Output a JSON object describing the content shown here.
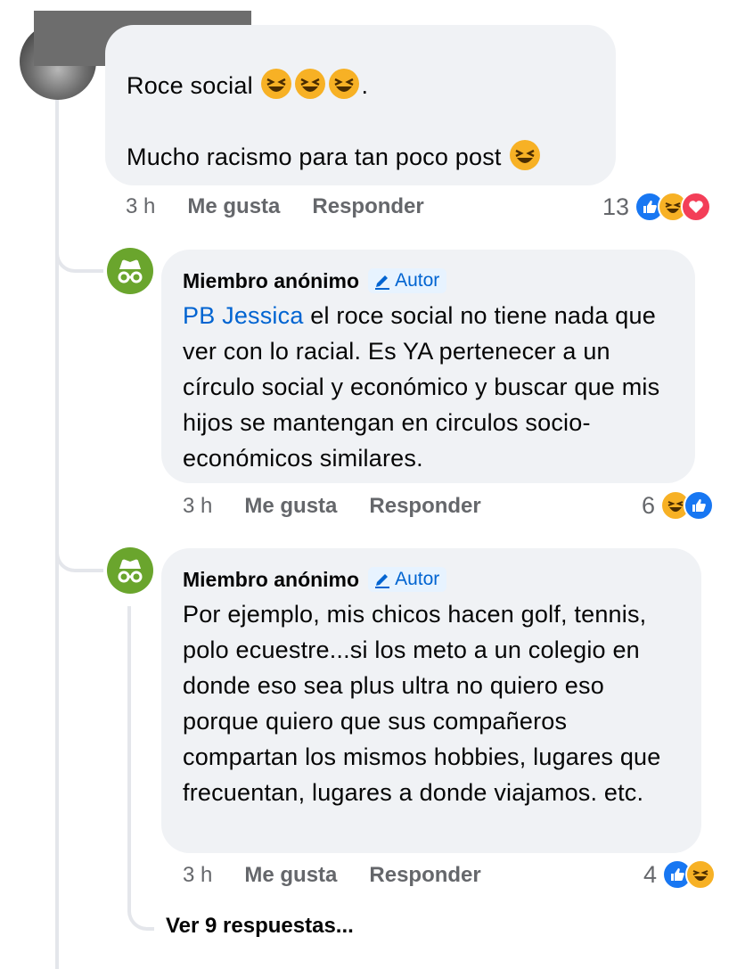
{
  "comments": [
    {
      "author": "",
      "lines": [
        "Roce social",
        ".",
        "Mucho racismo para tan poco post"
      ],
      "time": "3 h",
      "like_label": "Me gusta",
      "reply_label": "Responder",
      "reaction_count": "13",
      "reactions": [
        "like",
        "haha",
        "love"
      ]
    },
    {
      "author": "Miembro anónimo",
      "badge": "Autor",
      "mention": "PB Jessica",
      "text": "el roce social no tiene nada que ver con lo racial. Es YA pertenecer a un círculo social y económico y buscar que mis hijos se mantengan en circulos socio-económicos similares.",
      "time": "3 h",
      "like_label": "Me gusta",
      "reply_label": "Responder",
      "reaction_count": "6",
      "reactions": [
        "haha",
        "like"
      ]
    },
    {
      "author": "Miembro anónimo",
      "badge": "Autor",
      "text": "Por ejemplo, mis chicos hacen golf, tennis, polo ecuestre...si los meto a un colegio en donde eso sea plus ultra no quiero eso porque quiero que sus compañeros compartan los mismos hobbies, lugares que frecuentan, lugares a donde viajamos. etc.",
      "time": "3 h",
      "like_label": "Me gusta",
      "reply_label": "Responder",
      "reaction_count": "4",
      "reactions": [
        "like",
        "haha"
      ]
    }
  ],
  "more_replies": "Ver 9 respuestas...",
  "colors": {
    "like": "#1877f2",
    "haha": "#f7b125",
    "love": "#f33e58",
    "anon_avatar": "#6aa52d",
    "badge_text": "#0064d1"
  }
}
